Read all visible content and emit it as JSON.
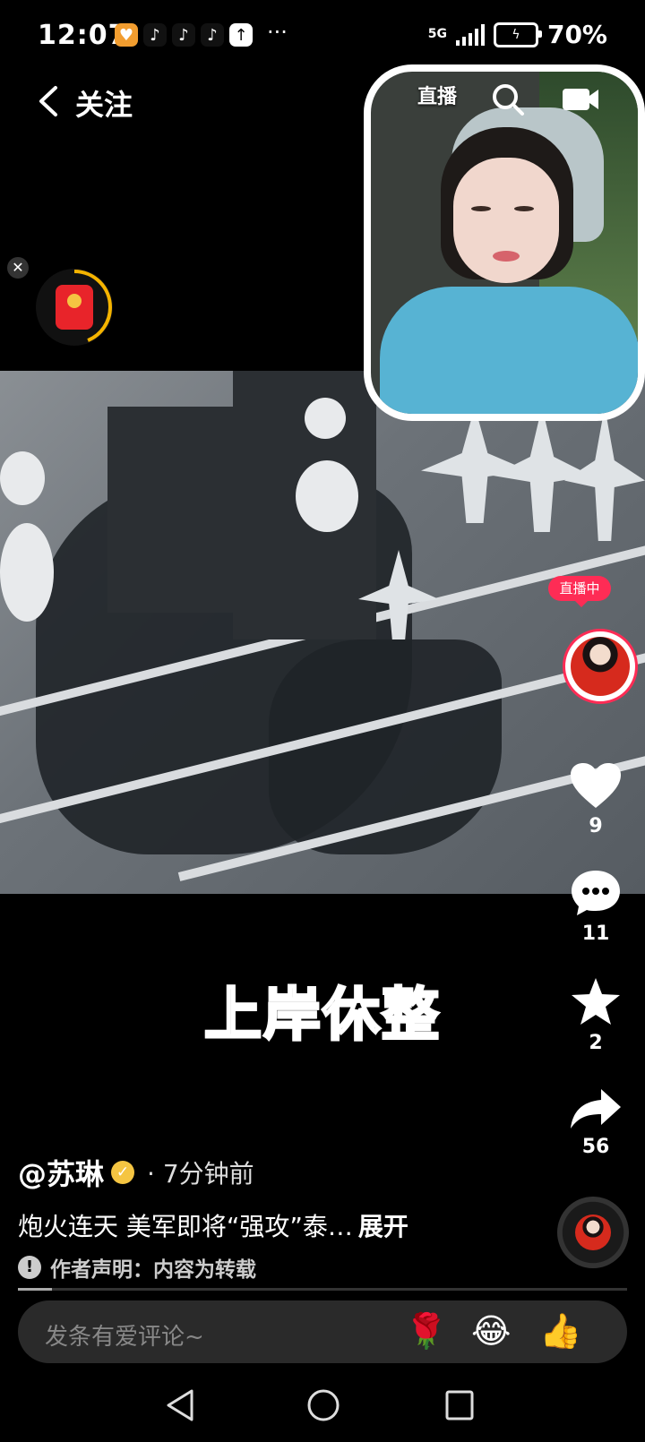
{
  "status_bar": {
    "time": "12:07",
    "network": "5G",
    "battery": "70%",
    "more": "···"
  },
  "header": {
    "title": "关注"
  },
  "pip": {
    "live_label": "直播"
  },
  "video": {
    "caption": "上岸休整"
  },
  "rail": {
    "live_badge": "直播中",
    "likes": "9",
    "comments": "11",
    "favorites": "2",
    "shares": "56"
  },
  "post": {
    "author": "@苏琳",
    "time_ago": "· 7分钟前",
    "description": "炮火连天 美军即将“强攻”泰…",
    "expand": "展开",
    "notice": "作者声明：内容为转载"
  },
  "comment": {
    "placeholder": "发条有爱评论~",
    "emojis": [
      "🌹",
      "😂",
      "👍"
    ]
  },
  "colors": {
    "accent": "#fe2c55",
    "verified": "#f5c542"
  }
}
